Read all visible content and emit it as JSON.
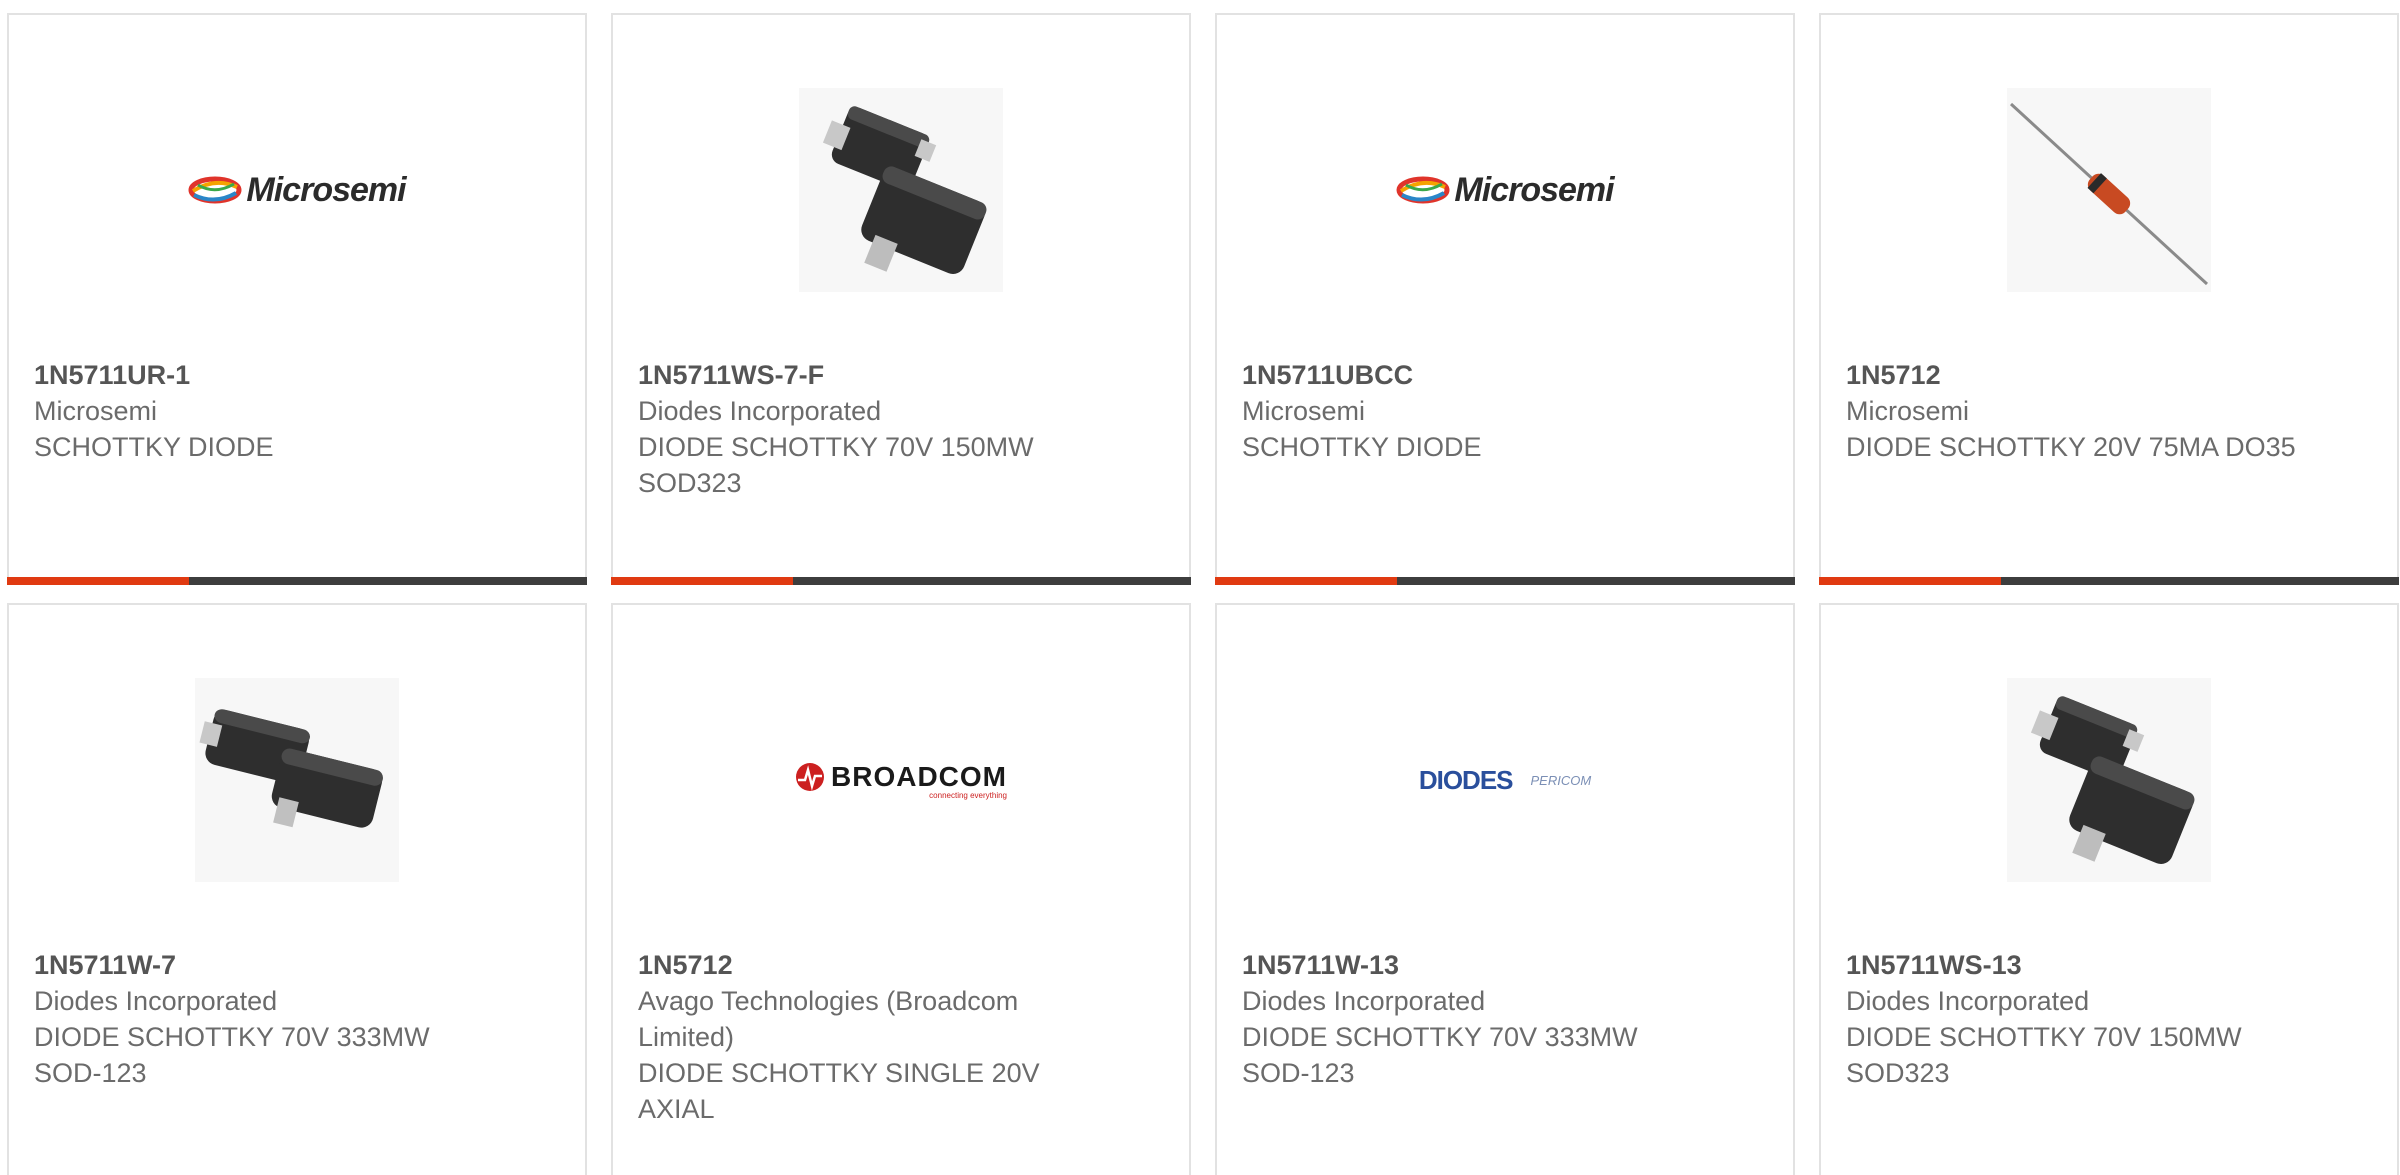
{
  "colors": {
    "accent": "#e03a11",
    "bar": "#3d3d3d",
    "card_border": "#e2e2e2",
    "text": "#6b6b6b"
  },
  "products": [
    {
      "part_number": "1N5711UR-1",
      "manufacturer": "Microsemi",
      "description": "SCHOTTKY DIODE",
      "image": "microsemi-logo",
      "logo_text": "Microsemi"
    },
    {
      "part_number": "1N5711WS-7-F",
      "manufacturer": "Diodes Incorporated",
      "description": "DIODE SCHOTTKY 70V 150MW SOD323",
      "image": "sod-package-photo"
    },
    {
      "part_number": "1N5711UBCC",
      "manufacturer": "Microsemi",
      "description": "SCHOTTKY DIODE",
      "image": "microsemi-logo",
      "logo_text": "Microsemi"
    },
    {
      "part_number": "1N5712",
      "manufacturer": "Microsemi",
      "description": "DIODE SCHOTTKY 20V 75MA DO35",
      "image": "axial-diode-photo"
    },
    {
      "part_number": "1N5711W-7",
      "manufacturer": "Diodes Incorporated",
      "description": "DIODE SCHOTTKY 70V 333MW SOD-123",
      "image": "sod-package-photo"
    },
    {
      "part_number": "1N5712",
      "manufacturer": "Avago Technologies (Broadcom Limited)",
      "description": "DIODE SCHOTTKY SINGLE 20V AXIAL",
      "image": "broadcom-logo",
      "logo_text": "BROADCOM",
      "logo_tagline": "connecting everything"
    },
    {
      "part_number": "1N5711W-13",
      "manufacturer": "Diodes Incorporated",
      "description": "DIODE SCHOTTKY 70V 333MW SOD-123",
      "image": "diodes-pericom-logo",
      "logo_text": "DIODES",
      "logo_text_2": "PERICOM"
    },
    {
      "part_number": "1N5711WS-13",
      "manufacturer": "Diodes Incorporated",
      "description": "DIODE SCHOTTKY 70V 150MW SOD323",
      "image": "sod-package-photo"
    }
  ]
}
